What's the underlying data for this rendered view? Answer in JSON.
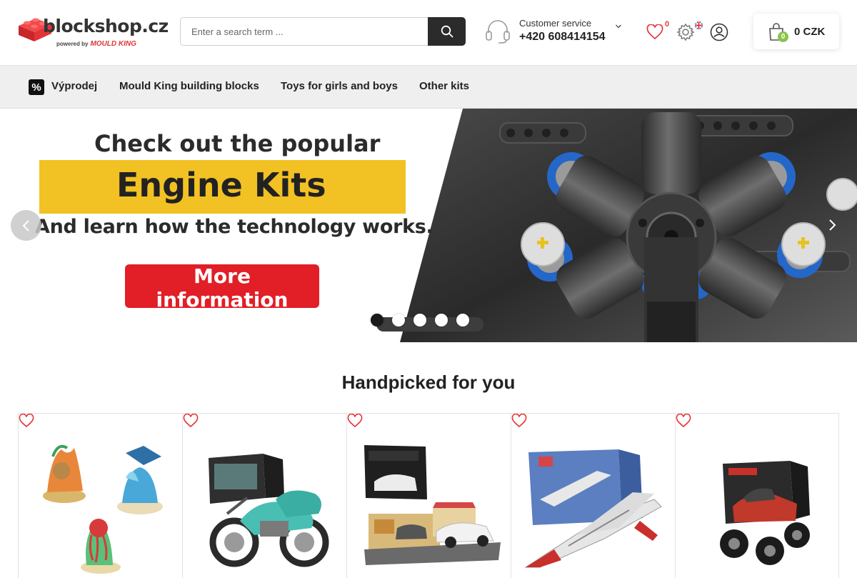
{
  "header": {
    "logo_text": "blockshop.cz",
    "logo_powered": "powered by",
    "logo_brand": "MOULD KING",
    "search_placeholder": "Enter a search term ...",
    "customer_service_label": "Customer service",
    "customer_service_phone": "+420 608414154",
    "wishlist_count": "0",
    "cart_count": "0",
    "cart_total": "0 CZK"
  },
  "nav": {
    "sale_symbol": "%",
    "items": [
      "Výprodej",
      "Mould King building blocks",
      "Toys for girls and boys",
      "Other kits"
    ]
  },
  "banner": {
    "line1": "Check out the popular",
    "line2": "Engine Kits",
    "line3": "And learn how the technology works.",
    "cta": "More information",
    "slide_count": 5,
    "active_slide": 1
  },
  "handpicked": {
    "title": "Handpicked for you",
    "products": [
      {
        "image": "underwater-sets-image"
      },
      {
        "image": "motorcycle-sidecar-kit-image"
      },
      {
        "image": "car-showroom-kit-image"
      },
      {
        "image": "jet-fighter-kit-image"
      },
      {
        "image": "monster-truck-kit-image"
      }
    ]
  },
  "colors": {
    "accent_red": "#e21e26",
    "banner_yellow": "#f2c123",
    "cart_badge_green": "#8bc34a",
    "dark": "#2b2b2b"
  }
}
